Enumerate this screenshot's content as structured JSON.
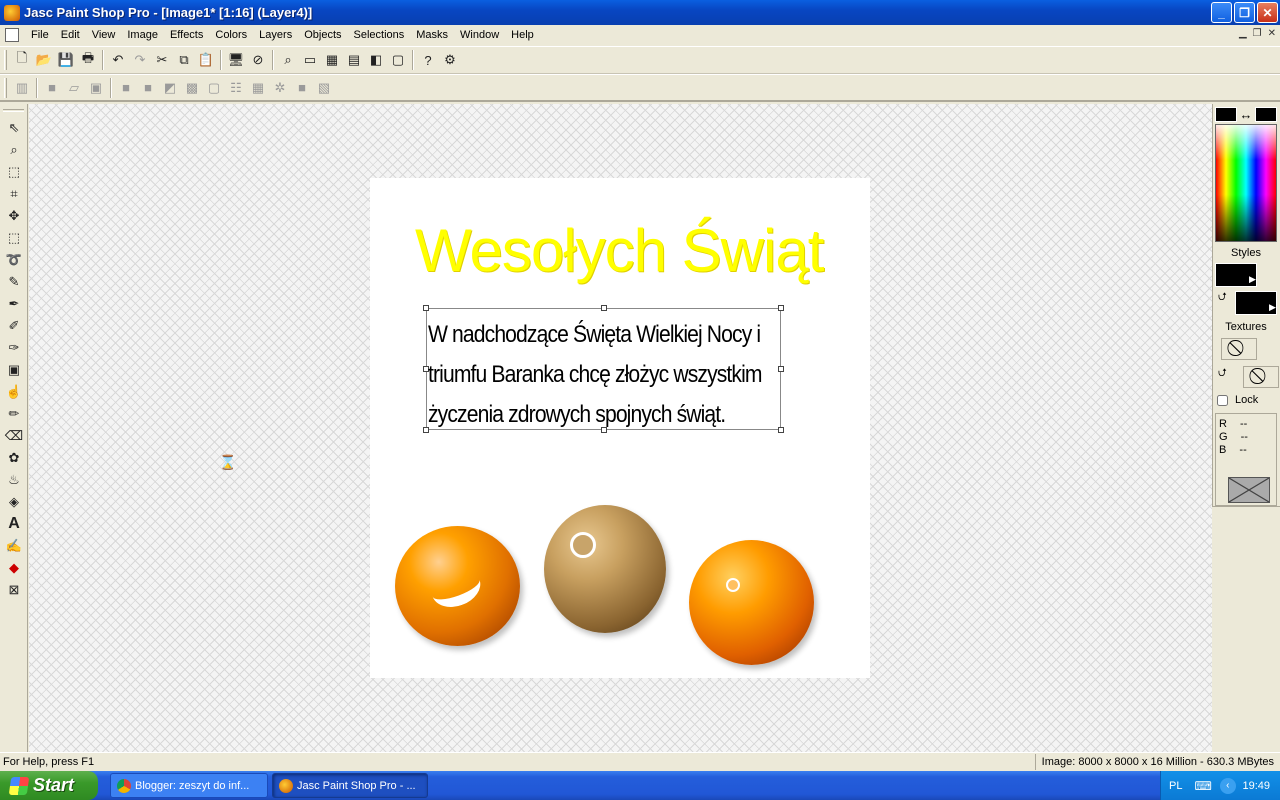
{
  "window": {
    "title": "Jasc Paint Shop Pro - [Image1* [1:16] (Layer4)]",
    "min_glyph": "_",
    "max_glyph": "❐",
    "close_glyph": "✕"
  },
  "menu": {
    "items": [
      "File",
      "Edit",
      "View",
      "Image",
      "Effects",
      "Colors",
      "Layers",
      "Objects",
      "Selections",
      "Masks",
      "Window",
      "Help"
    ]
  },
  "toolbar1": {
    "buttons": [
      "new-icon",
      "open-icon",
      "save-icon",
      "print-icon",
      "undo-icon",
      "redo-icon",
      "cut-icon",
      "copy-icon",
      "paste-icon",
      "browse-icon",
      "full-screen-icon",
      "zoom-icon",
      "histogram-icon",
      "layers-palette-icon",
      "overview-icon",
      "tool-options-icon",
      "color-palette-icon",
      "help-icon",
      "toolbar-options-icon"
    ]
  },
  "canvas": {
    "heading": "Wesołych Świąt",
    "body_lines": [
      "W nadchodzące Święta Wielkiej Nocy i",
      "triumfu Baranka chcę złożyc wszystkim",
      "życzenia zdrowych spojnych świąt."
    ]
  },
  "palette": {
    "swap_glyph": "↔",
    "styles_label": "Styles",
    "textures_label": "Textures",
    "lock_label": "Lock",
    "rgb": [
      {
        "channel": "R",
        "value": "--"
      },
      {
        "channel": "G",
        "value": "--"
      },
      {
        "channel": "B",
        "value": "--"
      }
    ],
    "foreground_color": "#000000",
    "background_color": "#000000"
  },
  "status": {
    "help": "For Help, press F1",
    "image_info": "Image:  8000 x 8000 x 16 Million - 630.3 MBytes"
  },
  "taskbar": {
    "start": "Start",
    "tasks": [
      {
        "label": "Blogger: zeszyt do inf..."
      },
      {
        "label": "Jasc Paint Shop Pro - ..."
      }
    ],
    "language": "PL",
    "clock": "19:49"
  }
}
